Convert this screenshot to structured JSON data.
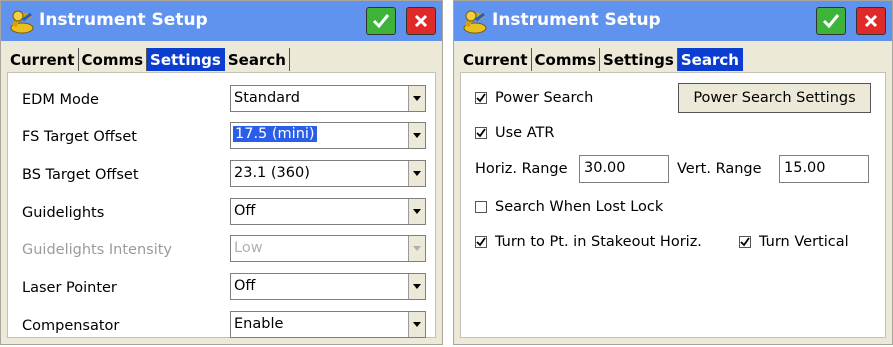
{
  "left": {
    "title": "Instrument Setup",
    "tabs": [
      "Current",
      "Comms",
      "Settings",
      "Search"
    ],
    "active_tab": "Settings",
    "settings": [
      {
        "label": "EDM Mode",
        "value": "Standard",
        "enabled": true,
        "selected": false
      },
      {
        "label": "FS Target Offset",
        "value": "17.5 (mini)",
        "enabled": true,
        "selected": true
      },
      {
        "label": "BS Target Offset",
        "value": "23.1 (360)",
        "enabled": true,
        "selected": false
      },
      {
        "label": "Guidelights",
        "value": "Off",
        "enabled": true,
        "selected": false
      },
      {
        "label": "Guidelights Intensity",
        "value": "Low",
        "enabled": false,
        "selected": false
      },
      {
        "label": "Laser Pointer",
        "value": "Off",
        "enabled": true,
        "selected": false
      },
      {
        "label": "Compensator",
        "value": "Enable",
        "enabled": true,
        "selected": false
      }
    ]
  },
  "right": {
    "title": "Instrument Setup",
    "tabs": [
      "Current",
      "Comms",
      "Settings",
      "Search"
    ],
    "active_tab": "Search",
    "power_search": {
      "label": "Power Search",
      "checked": true
    },
    "power_search_settings_button": "Power Search Settings",
    "use_atr": {
      "label": "Use ATR",
      "checked": true
    },
    "horiz_range": {
      "label": "Horiz. Range",
      "value": "30.00"
    },
    "vert_range": {
      "label": "Vert. Range",
      "value": "15.00"
    },
    "search_when_lost_lock": {
      "label": "Search When Lost Lock",
      "checked": false
    },
    "turn_to_pt": {
      "label": "Turn to Pt. in Stakeout Horiz.",
      "checked": true
    },
    "turn_vertical": {
      "label": "Turn Vertical",
      "checked": true
    }
  },
  "colors": {
    "titlebar": "#5f93ee",
    "active_tab": "#0a3dd0",
    "ok": "#3db33a",
    "cancel": "#e02a2a",
    "selection": "#2b5ee8"
  },
  "icons": {
    "title": "instrument-icon",
    "ok": "checkmark-icon",
    "cancel": "close-icon",
    "dropdown": "dropdown-arrow-icon"
  }
}
